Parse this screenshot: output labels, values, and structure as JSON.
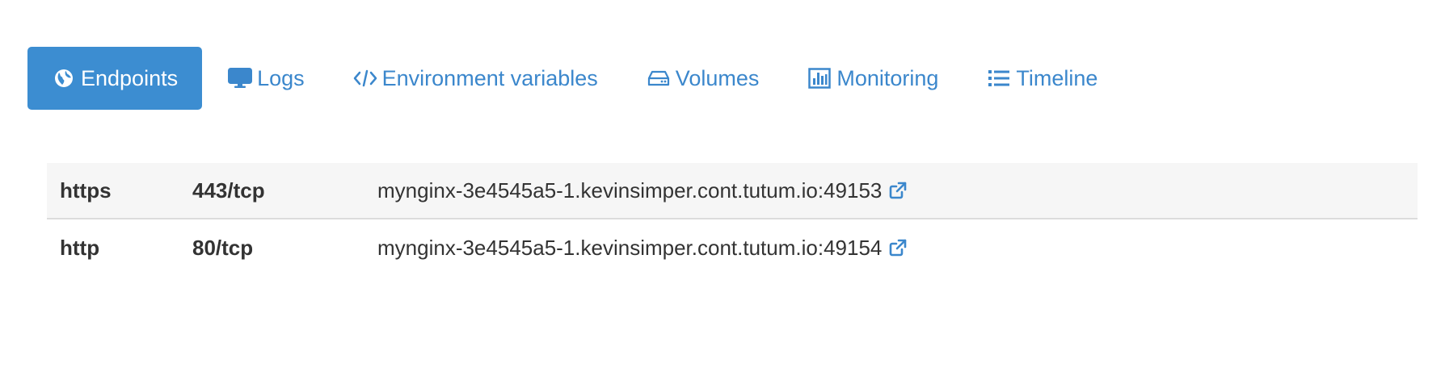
{
  "tabs": [
    {
      "id": "endpoints",
      "label": "Endpoints",
      "icon": "globe-icon",
      "active": true
    },
    {
      "id": "logs",
      "label": "Logs",
      "icon": "monitor-icon",
      "active": false
    },
    {
      "id": "env",
      "label": "Environment variables",
      "icon": "code-icon",
      "active": false
    },
    {
      "id": "volumes",
      "label": "Volumes",
      "icon": "hard-drive-icon",
      "active": false
    },
    {
      "id": "monitoring",
      "label": "Monitoring",
      "icon": "bar-chart-icon",
      "active": false
    },
    {
      "id": "timeline",
      "label": "Timeline",
      "icon": "list-icon",
      "active": false
    }
  ],
  "endpoints": [
    {
      "protocol": "https",
      "port": "443/tcp",
      "url": "mynginx-3e4545a5-1.kevinsimper.cont.tutum.io:49153"
    },
    {
      "protocol": "http",
      "port": "80/tcp",
      "url": "mynginx-3e4545a5-1.kevinsimper.cont.tutum.io:49154"
    }
  ],
  "colors": {
    "accent": "#3c8dd1",
    "link": "#3b87cc",
    "text": "#333333",
    "row_stripe": "#f6f6f6"
  }
}
